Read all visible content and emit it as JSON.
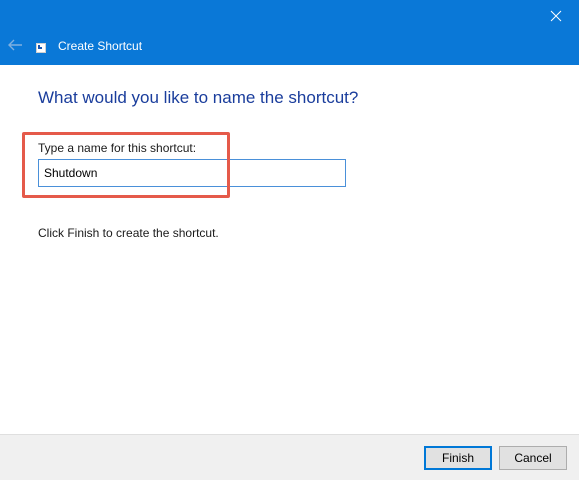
{
  "window": {
    "title": "Create Shortcut",
    "accent_color": "#0a78d7"
  },
  "icons": {
    "back": "back-arrow-icon",
    "close": "close-icon",
    "app": "shortcut-icon"
  },
  "page": {
    "heading": "What would you like to name the shortcut?",
    "field_label": "Type a name for this shortcut:",
    "field_value": "Shutdown",
    "hint": "Click Finish to create the shortcut.",
    "highlight_color": "#e55a4a"
  },
  "footer": {
    "finish_label": "Finish",
    "cancel_label": "Cancel"
  }
}
